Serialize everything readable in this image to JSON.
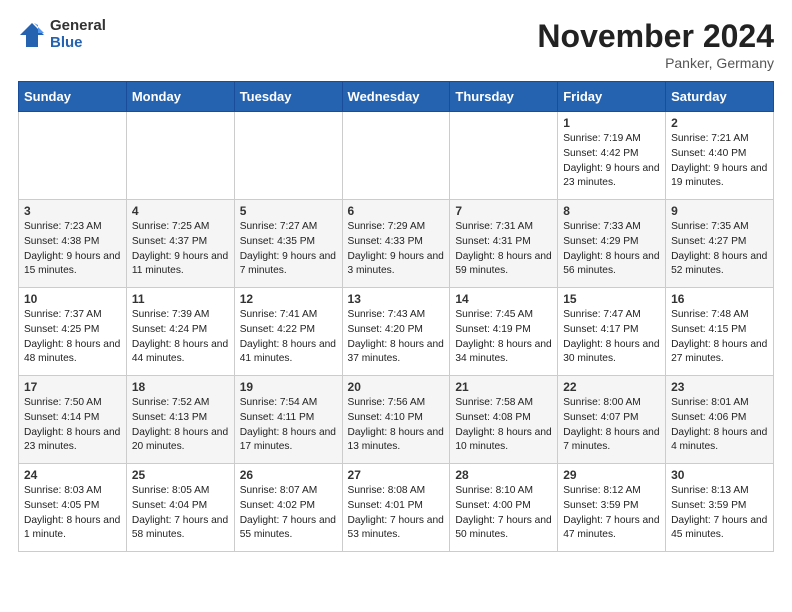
{
  "header": {
    "logo_general": "General",
    "logo_blue": "Blue",
    "month_title": "November 2024",
    "location": "Panker, Germany"
  },
  "days_of_week": [
    "Sunday",
    "Monday",
    "Tuesday",
    "Wednesday",
    "Thursday",
    "Friday",
    "Saturday"
  ],
  "weeks": [
    [
      {
        "day": "",
        "info": ""
      },
      {
        "day": "",
        "info": ""
      },
      {
        "day": "",
        "info": ""
      },
      {
        "day": "",
        "info": ""
      },
      {
        "day": "",
        "info": ""
      },
      {
        "day": "1",
        "info": "Sunrise: 7:19 AM\nSunset: 4:42 PM\nDaylight: 9 hours\nand 23 minutes."
      },
      {
        "day": "2",
        "info": "Sunrise: 7:21 AM\nSunset: 4:40 PM\nDaylight: 9 hours\nand 19 minutes."
      }
    ],
    [
      {
        "day": "3",
        "info": "Sunrise: 7:23 AM\nSunset: 4:38 PM\nDaylight: 9 hours\nand 15 minutes."
      },
      {
        "day": "4",
        "info": "Sunrise: 7:25 AM\nSunset: 4:37 PM\nDaylight: 9 hours\nand 11 minutes."
      },
      {
        "day": "5",
        "info": "Sunrise: 7:27 AM\nSunset: 4:35 PM\nDaylight: 9 hours\nand 7 minutes."
      },
      {
        "day": "6",
        "info": "Sunrise: 7:29 AM\nSunset: 4:33 PM\nDaylight: 9 hours\nand 3 minutes."
      },
      {
        "day": "7",
        "info": "Sunrise: 7:31 AM\nSunset: 4:31 PM\nDaylight: 8 hours\nand 59 minutes."
      },
      {
        "day": "8",
        "info": "Sunrise: 7:33 AM\nSunset: 4:29 PM\nDaylight: 8 hours\nand 56 minutes."
      },
      {
        "day": "9",
        "info": "Sunrise: 7:35 AM\nSunset: 4:27 PM\nDaylight: 8 hours\nand 52 minutes."
      }
    ],
    [
      {
        "day": "10",
        "info": "Sunrise: 7:37 AM\nSunset: 4:25 PM\nDaylight: 8 hours\nand 48 minutes."
      },
      {
        "day": "11",
        "info": "Sunrise: 7:39 AM\nSunset: 4:24 PM\nDaylight: 8 hours\nand 44 minutes."
      },
      {
        "day": "12",
        "info": "Sunrise: 7:41 AM\nSunset: 4:22 PM\nDaylight: 8 hours\nand 41 minutes."
      },
      {
        "day": "13",
        "info": "Sunrise: 7:43 AM\nSunset: 4:20 PM\nDaylight: 8 hours\nand 37 minutes."
      },
      {
        "day": "14",
        "info": "Sunrise: 7:45 AM\nSunset: 4:19 PM\nDaylight: 8 hours\nand 34 minutes."
      },
      {
        "day": "15",
        "info": "Sunrise: 7:47 AM\nSunset: 4:17 PM\nDaylight: 8 hours\nand 30 minutes."
      },
      {
        "day": "16",
        "info": "Sunrise: 7:48 AM\nSunset: 4:15 PM\nDaylight: 8 hours\nand 27 minutes."
      }
    ],
    [
      {
        "day": "17",
        "info": "Sunrise: 7:50 AM\nSunset: 4:14 PM\nDaylight: 8 hours\nand 23 minutes."
      },
      {
        "day": "18",
        "info": "Sunrise: 7:52 AM\nSunset: 4:13 PM\nDaylight: 8 hours\nand 20 minutes."
      },
      {
        "day": "19",
        "info": "Sunrise: 7:54 AM\nSunset: 4:11 PM\nDaylight: 8 hours\nand 17 minutes."
      },
      {
        "day": "20",
        "info": "Sunrise: 7:56 AM\nSunset: 4:10 PM\nDaylight: 8 hours\nand 13 minutes."
      },
      {
        "day": "21",
        "info": "Sunrise: 7:58 AM\nSunset: 4:08 PM\nDaylight: 8 hours\nand 10 minutes."
      },
      {
        "day": "22",
        "info": "Sunrise: 8:00 AM\nSunset: 4:07 PM\nDaylight: 8 hours\nand 7 minutes."
      },
      {
        "day": "23",
        "info": "Sunrise: 8:01 AM\nSunset: 4:06 PM\nDaylight: 8 hours\nand 4 minutes."
      }
    ],
    [
      {
        "day": "24",
        "info": "Sunrise: 8:03 AM\nSunset: 4:05 PM\nDaylight: 8 hours\nand 1 minute."
      },
      {
        "day": "25",
        "info": "Sunrise: 8:05 AM\nSunset: 4:04 PM\nDaylight: 7 hours\nand 58 minutes."
      },
      {
        "day": "26",
        "info": "Sunrise: 8:07 AM\nSunset: 4:02 PM\nDaylight: 7 hours\nand 55 minutes."
      },
      {
        "day": "27",
        "info": "Sunrise: 8:08 AM\nSunset: 4:01 PM\nDaylight: 7 hours\nand 53 minutes."
      },
      {
        "day": "28",
        "info": "Sunrise: 8:10 AM\nSunset: 4:00 PM\nDaylight: 7 hours\nand 50 minutes."
      },
      {
        "day": "29",
        "info": "Sunrise: 8:12 AM\nSunset: 3:59 PM\nDaylight: 7 hours\nand 47 minutes."
      },
      {
        "day": "30",
        "info": "Sunrise: 8:13 AM\nSunset: 3:59 PM\nDaylight: 7 hours\nand 45 minutes."
      }
    ]
  ]
}
